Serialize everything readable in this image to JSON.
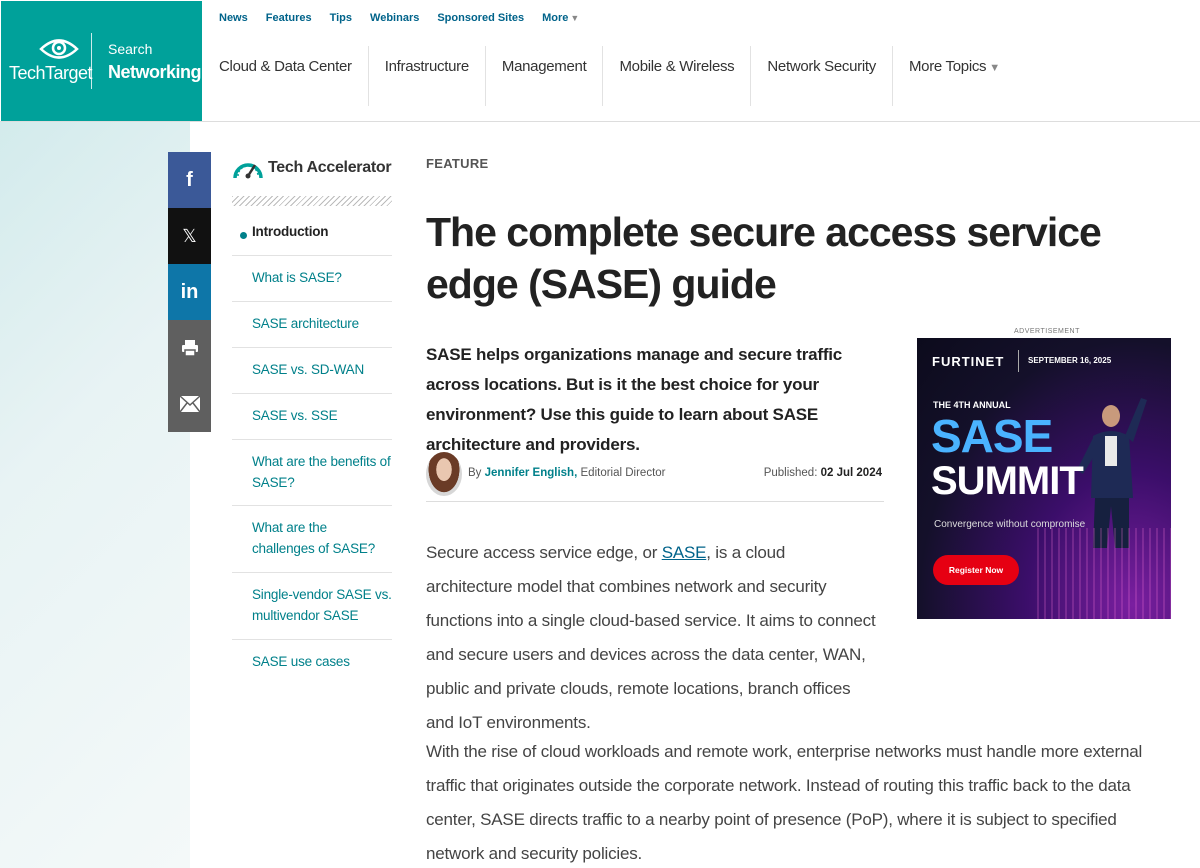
{
  "brand": {
    "name": "TechTarget",
    "search_label": "Search",
    "section_label": "Networking",
    "color": "#00a19a"
  },
  "top_links": [
    "News",
    "Features",
    "Tips",
    "Webinars",
    "Sponsored Sites",
    "More"
  ],
  "main_nav": [
    "Cloud & Data Center",
    "Infrastructure",
    "Management",
    "Mobile & Wireless",
    "Network Security",
    "More Topics"
  ],
  "share": {
    "facebook": "f",
    "x": "𝕏",
    "linkedin": "in",
    "icons": [
      "facebook-icon",
      "x-icon",
      "linkedin-icon",
      "print-icon",
      "mail-icon"
    ]
  },
  "toc": {
    "title": "Tech Accelerator",
    "items": [
      "Introduction",
      "What is SASE?",
      "SASE architecture",
      "SASE vs. SD-WAN",
      "SASE vs. SSE",
      "What are the benefits of SASE?",
      "What are the challenges of SASE?",
      "Single-vendor SASE vs. multivendor SASE",
      "SASE use cases"
    ]
  },
  "article": {
    "kicker": "FEATURE",
    "title": "The complete secure access service edge (SASE) guide",
    "lede": "SASE helps organizations manage and secure traffic across locations. But is it the best choice for your environment? Use this guide to learn about SASE architecture and providers.",
    "by_prefix": "By",
    "author": "Jennifer English,",
    "author_role": "Editorial Director",
    "published_label": "Published:",
    "published_date": "02 Jul 2024",
    "para1_before": "Secure access service edge, or ",
    "para1_link": "SASE",
    "para1_after": ", is a cloud architecture model that combines network and security functions into a single cloud-based service. It aims to connect and secure users and devices across the data center, WAN, public and private clouds, remote locations, branch offices and IoT environments.",
    "para2": "With the rise of cloud workloads and remote work, enterprise networks must handle more external traffic that originates outside the corporate network. Instead of routing this traffic back to the data center, SASE directs traffic to a nearby point of presence (PoP), where it is subject to specified network and security policies."
  },
  "ad": {
    "label": "ADVERTISEMENT",
    "brand": "FURTINET",
    "date": "SEPTEMBER 16, 2025",
    "annual": "THE 4TH ANNUAL",
    "headline1": "SASE",
    "headline2": "SUMMIT",
    "tagline": "Convergence without compromise",
    "cta": "Register Now"
  }
}
